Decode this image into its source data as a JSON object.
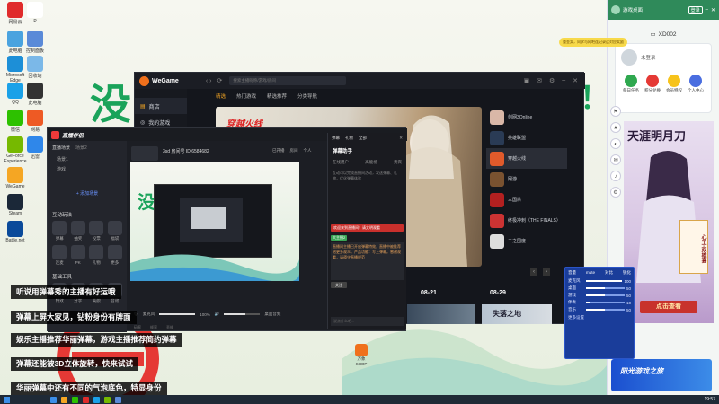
{
  "desktop": {
    "icons": [
      {
        "label": "网易云",
        "color": "#e02b2b"
      },
      {
        "label": "P",
        "color": "#ffffff"
      },
      {
        "label": "此电脑",
        "color": "#4aa3df"
      },
      {
        "label": "控制面板",
        "color": "#5a8ad8"
      },
      {
        "label": "Microsoft Edge",
        "color": "#1d8fd7"
      },
      {
        "label": "回收站",
        "color": "#7bb8e8"
      },
      {
        "label": "QQ",
        "color": "#1aa1e8"
      },
      {
        "label": "此电脑",
        "color": "#333"
      },
      {
        "label": "微信",
        "color": "#2dc100"
      },
      {
        "label": "网易",
        "color": "#ee5a24"
      },
      {
        "label": "GeForce Experience",
        "color": "#76b900"
      },
      {
        "label": "迅雷",
        "color": "#2f87ea"
      },
      {
        "label": "WeGame",
        "color": "#f5a623"
      },
      {
        "label": "Steam",
        "color": "#1b2838"
      },
      {
        "label": "Battle.net",
        "color": "#0a4a9a"
      }
    ],
    "wallpaper_text": [
      "没",
      "！"
    ],
    "shop_label": "万象SHOP"
  },
  "wegame": {
    "logo": "WeGame",
    "search_placeholder": "搜索主播昵称/游戏/房间",
    "sidebar": [
      {
        "label": "商店",
        "icon": "bag-icon",
        "active": true
      },
      {
        "label": "我的游戏",
        "icon": "controller-icon",
        "active": false
      }
    ],
    "tabs": [
      {
        "label": "精选",
        "active": true
      },
      {
        "label": "热门游戏",
        "active": false
      },
      {
        "label": "精选推荐",
        "active": false
      },
      {
        "label": "分类导航",
        "active": false
      }
    ],
    "banner_title": "穿越火线",
    "games": [
      {
        "label": "剑网3Online",
        "color": "#d9b7a7"
      },
      {
        "label": "英雄联盟",
        "color": "#2a3b55"
      },
      {
        "label": "穿越火线",
        "color": "#e05a2b",
        "active": true
      },
      {
        "label": "网游",
        "color": "#7a5230"
      },
      {
        "label": "三国杀",
        "color": "#b32020"
      },
      {
        "label": "终极冲刺（THE FINALS）",
        "color": "#cc3333"
      },
      {
        "label": "二之国度",
        "color": "#ddd"
      }
    ],
    "dates": [
      "08-21",
      "08-29"
    ],
    "thumb_text": "失落之地"
  },
  "live": {
    "logo": "直播伴侣",
    "streamer_title": "3sd 房间号 ID 6584682",
    "scene_tabs": [
      "直播场景",
      "场景2"
    ],
    "scene_sources": [
      "场景1",
      "游戏"
    ],
    "add_scene": "+ 添加场景",
    "stream_settings": "直播设置",
    "tools_header": "互动玩法",
    "tools": [
      "弹幕",
      "抽奖",
      "投票",
      "福袋",
      "连麦",
      "PK",
      "礼物",
      "更多"
    ],
    "tools_header2": "基础工具",
    "tools2": [
      "特效",
      "分享",
      "美颜",
      "音效"
    ],
    "status": [
      "码率",
      "帧率",
      "丢帧"
    ],
    "audio_labels": [
      "麦克风",
      "100%",
      "桌面音频"
    ],
    "go_live": "开始直播",
    "top_right": [
      "已开播",
      "房间",
      "个人"
    ]
  },
  "danmaku": {
    "title": "弹幕助手",
    "tabs": [
      "弹幕",
      "礼物",
      "全部"
    ],
    "subtabs": [
      "在线用户",
      "高能榜",
      "贵宾"
    ],
    "hint": "互动可以完成直播间活动，发送弹幕、礼物，优化弹幕体验",
    "notice": "欢迎来到直播间！请文明观看",
    "system_msg": "直播间主播已开启弹幕特效，直播中被推荐给更多观众。产品功能：写上弹幕。感谢观看，请遵守直播规范",
    "user_badge": "大主播2",
    "follow": "关注",
    "input_placeholder": "说点什么吧..."
  },
  "rpanel": {
    "title": "游戏桌面",
    "login_btn": "登录",
    "register": "注册",
    "promo": "重金奖，同学与网吧连记录这对应奖励",
    "machine": "XD002",
    "user": "未登录",
    "quick": [
      {
        "label": "每日任务",
        "color": "#2fa84f"
      },
      {
        "label": "积分兑换",
        "color": "#e53935"
      },
      {
        "label": "会员特权",
        "color": "#f7c31b"
      },
      {
        "label": "个人中心",
        "color": "#4a6ee0"
      }
    ],
    "poster_title": "天涯明月刀",
    "poster_sub": "心工·双雄宴",
    "poster_cta": "点击查看",
    "ad_text": "阳光游戏之旅",
    "side_icons": [
      "⚑",
      "★",
      "◐",
      "✉",
      "♪",
      "⚙"
    ]
  },
  "mixer": {
    "header": [
      "音量",
      "mute",
      "对比",
      "锐化"
    ],
    "rows": [
      {
        "label": "麦克风",
        "value": "100",
        "level": 1.0
      },
      {
        "label": "桌面",
        "value": "50",
        "level": 0.5
      },
      {
        "label": "游戏",
        "value": "50",
        "level": 0.5
      },
      {
        "label": "伴奏",
        "value": "10",
        "level": 0.1
      },
      {
        "label": "音乐",
        "value": "50",
        "level": 0.5
      }
    ],
    "footer": "更多设置"
  },
  "captions": [
    "听说用弹幕秀的主播有好运哦",
    "弹幕上屏大家见，钻粉身份有牌面",
    "娱乐主播推荐华丽弹幕，游戏主播推荐简约弹幕",
    "弹幕还能被3D立体旋转，快来试试",
    "华丽弹幕中还有不同的气泡底色，特显身份"
  ],
  "taskbar": {
    "time": "19:57",
    "colors": [
      "#3c8fe8",
      "#f5a623",
      "#2dc100",
      "#e02b2b",
      "#1aa1e8",
      "#76b900",
      "#5a8ad8"
    ]
  }
}
